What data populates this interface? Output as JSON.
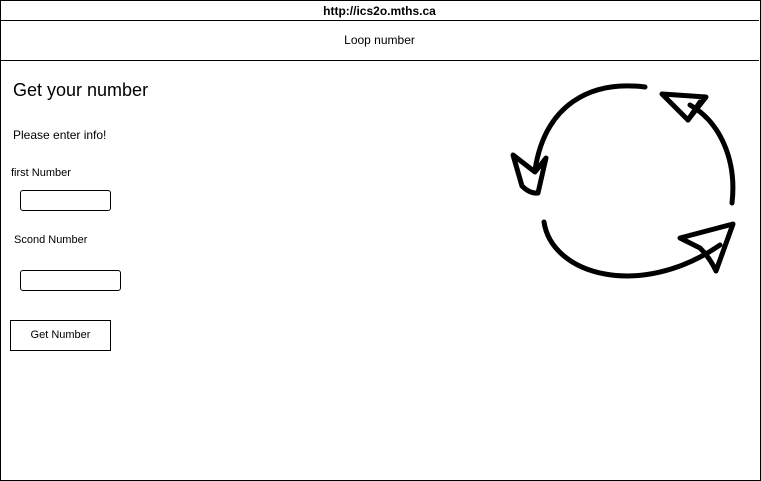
{
  "browser": {
    "url": "http://ics2o.mths.ca"
  },
  "app": {
    "title": "Loop number"
  },
  "main": {
    "heading": "Get your number",
    "prompt": "Please enter info!",
    "first_label": "first Number",
    "first_value": "",
    "second_label": "Scond Number",
    "second_value": "",
    "button_label": "Get Number"
  },
  "icons": {
    "loop": "circular-arrows-icon"
  }
}
